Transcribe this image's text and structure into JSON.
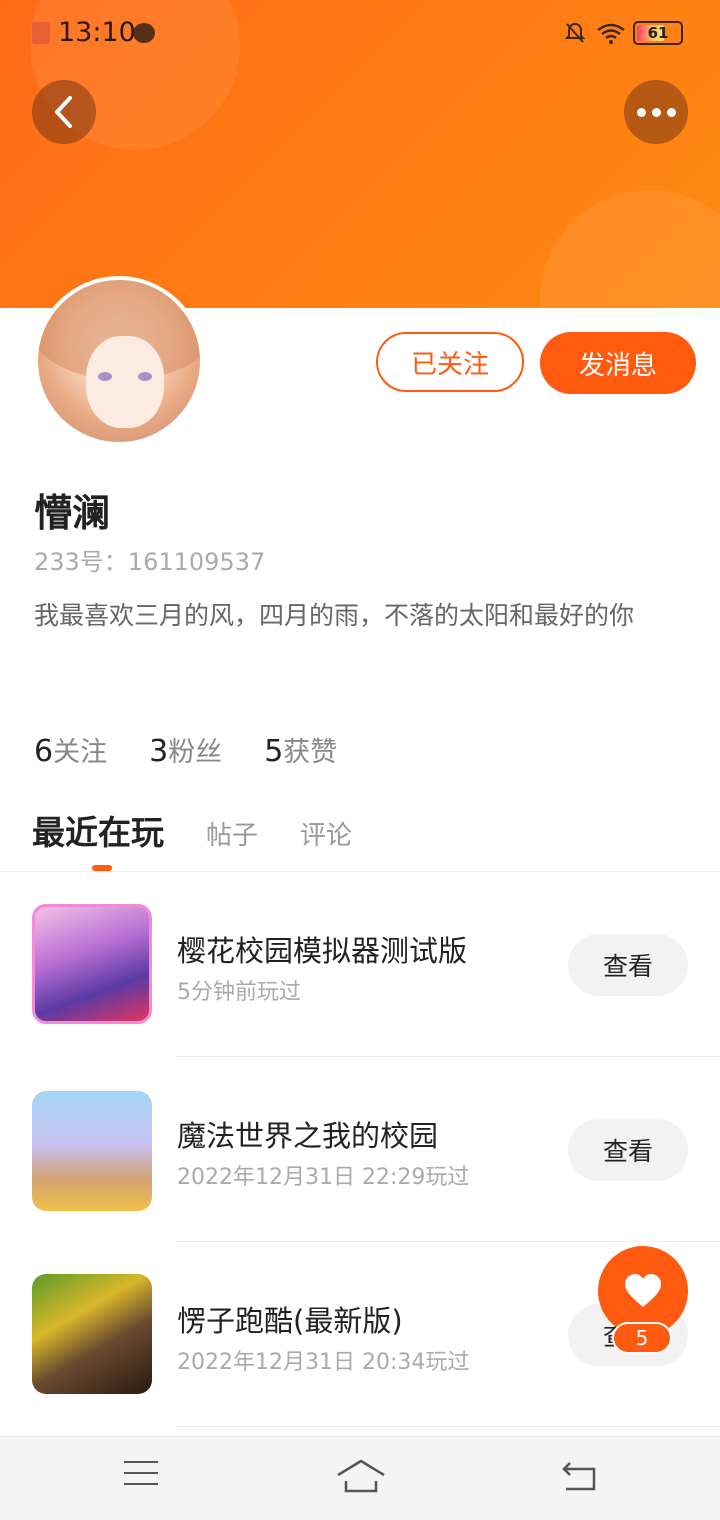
{
  "status_bar": {
    "time": "13:10",
    "battery": "61"
  },
  "profile": {
    "follow_label": "已关注",
    "message_label": "发消息",
    "username": "懵澜",
    "user_id": "233号：161109537",
    "bio": "我最喜欢三月的风，四月的雨，不落的太阳和最好的你"
  },
  "stats": [
    {
      "num": "6",
      "label": "关注"
    },
    {
      "num": "3",
      "label": "粉丝"
    },
    {
      "num": "5",
      "label": "获赞"
    }
  ],
  "tabs": [
    "最近在玩",
    "帖子",
    "评论"
  ],
  "games": [
    {
      "title": "樱花校园模拟器测试版",
      "played": "5分钟前玩过",
      "button": "查看"
    },
    {
      "title": "魔法世界之我的校园",
      "played": "2022年12月31日 22:29玩过",
      "button": "查看"
    },
    {
      "title": "愣子跑酷(最新版)",
      "played": "2022年12月31日 20:34玩过",
      "button": "查看"
    }
  ],
  "float_like": {
    "count": "5"
  },
  "colors": {
    "accent": "#ff5a10",
    "banner": "#ff7a14"
  }
}
